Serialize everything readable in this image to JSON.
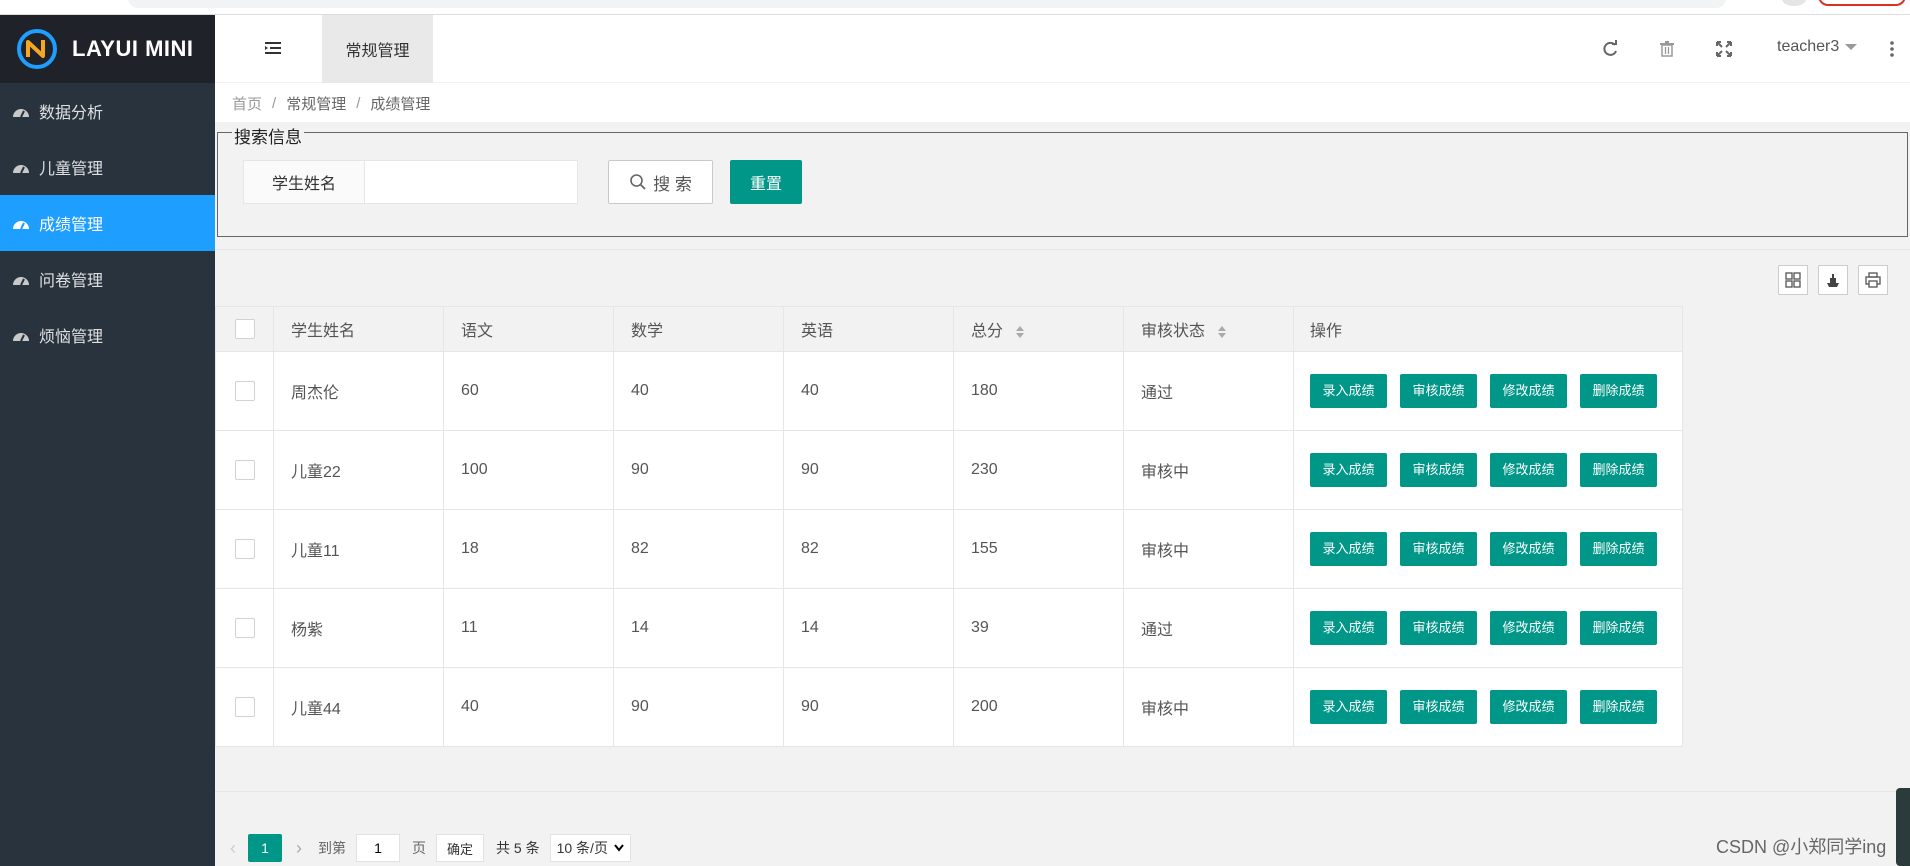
{
  "app": {
    "title": "LAYUI MINI"
  },
  "sidebar": {
    "items": [
      {
        "label": "数据分析",
        "active": false
      },
      {
        "label": "儿童管理",
        "active": false
      },
      {
        "label": "成绩管理",
        "active": true
      },
      {
        "label": "问卷管理",
        "active": false
      },
      {
        "label": "烦恼管理",
        "active": false
      }
    ]
  },
  "header": {
    "tab": "常规管理",
    "user": "teacher3",
    "icons": [
      "menu-toggle-icon",
      "refresh-icon",
      "clear-cache-icon",
      "fullscreen-icon",
      "more-icon"
    ]
  },
  "breadcrumb": [
    "首页",
    "常规管理",
    "成绩管理"
  ],
  "search": {
    "legend": "搜索信息",
    "field_label": "学生姓名",
    "field_value": "",
    "search_button": "搜 索",
    "reset_button": "重置"
  },
  "table": {
    "columns": [
      "学生姓名",
      "语文",
      "数学",
      "英语",
      "总分",
      "审核状态",
      "操作"
    ],
    "rows": [
      {
        "name": "周杰伦",
        "chinese": "60",
        "math": "40",
        "english": "40",
        "total": "180",
        "status": "通过"
      },
      {
        "name": "儿童22",
        "chinese": "100",
        "math": "90",
        "english": "90",
        "total": "230",
        "status": "审核中"
      },
      {
        "name": "儿童11",
        "chinese": "18",
        "math": "82",
        "english": "82",
        "total": "155",
        "status": "审核中"
      },
      {
        "name": "杨紫",
        "chinese": "11",
        "math": "14",
        "english": "14",
        "total": "39",
        "status": "通过"
      },
      {
        "name": "儿童44",
        "chinese": "40",
        "math": "90",
        "english": "90",
        "total": "200",
        "status": "审核中"
      }
    ],
    "actions": [
      "录入成绩",
      "审核成绩",
      "修改成绩",
      "删除成绩"
    ]
  },
  "pager": {
    "current": "1",
    "goto_label": "到第",
    "goto_value": "1",
    "page_label": "页",
    "confirm": "确定",
    "total": "共 5 条",
    "page_size": "10 条/页"
  },
  "watermark": "CSDN @小郑同学ing",
  "colors": {
    "sidebar": "#28333e",
    "logo_bg": "#20222a",
    "active": "#1e9fff",
    "primary": "#009688"
  }
}
